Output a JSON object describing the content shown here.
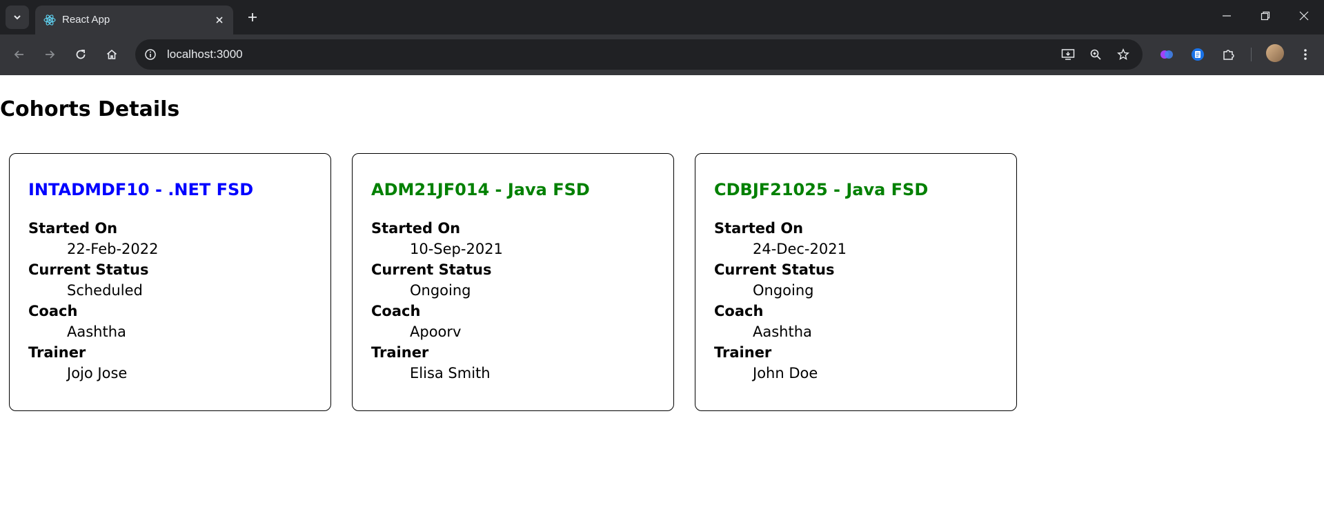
{
  "browser": {
    "tab_title": "React App",
    "url": "localhost:3000",
    "icons": {
      "tab_search": "chevron-down-icon",
      "favicon": "react-logo-icon",
      "close_tab": "close-icon",
      "new_tab": "plus-icon",
      "back": "arrow-left-icon",
      "forward": "arrow-right-icon",
      "reload": "reload-icon",
      "home": "home-icon",
      "site_info": "info-icon",
      "install": "install-app-icon",
      "zoom": "zoom-icon",
      "bookmark": "star-icon",
      "extensions": "puzzle-icon",
      "menu": "more-vertical-icon"
    }
  },
  "page": {
    "heading": "Cohorts Details"
  },
  "cohorts": [
    {
      "title": "INTADMDF10 - .NET FSD",
      "title_color": "#0000ff",
      "started_label": "Started On",
      "started": "22-Feb-2022",
      "status_label": "Current Status",
      "status": "Scheduled",
      "coach_label": "Coach",
      "coach": "Aashtha",
      "trainer_label": "Trainer",
      "trainer": "Jojo Jose"
    },
    {
      "title": "ADM21JF014 - Java FSD",
      "title_color": "#008000",
      "started_label": "Started On",
      "started": "10-Sep-2021",
      "status_label": "Current Status",
      "status": "Ongoing",
      "coach_label": "Coach",
      "coach": "Apoorv",
      "trainer_label": "Trainer",
      "trainer": "Elisa Smith"
    },
    {
      "title": "CDBJF21025 - Java FSD",
      "title_color": "#008000",
      "started_label": "Started On",
      "started": "24-Dec-2021",
      "status_label": "Current Status",
      "status": "Ongoing",
      "coach_label": "Coach",
      "coach": "Aashtha",
      "trainer_label": "Trainer",
      "trainer": "John Doe"
    }
  ]
}
